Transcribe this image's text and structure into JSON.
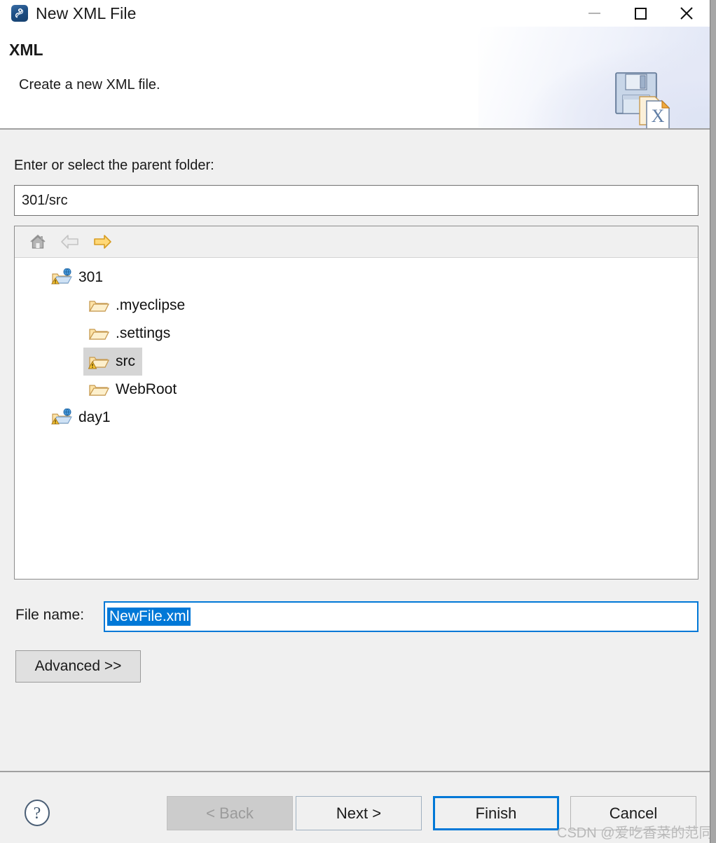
{
  "window": {
    "title": "New XML File",
    "icon": "xml-wizard-icon",
    "controls": {
      "minimize": "minimize-icon",
      "maximize": "maximize-icon",
      "close": "close-icon"
    }
  },
  "header": {
    "title": "XML",
    "description": "Create a new XML file.",
    "art": "floppy-disk-xml-document-icon"
  },
  "form": {
    "parent_folder_label": "Enter or select the parent folder:",
    "parent_folder_value": "301/src",
    "file_name_label": "File name:",
    "file_name_value": "NewFile.xml",
    "advanced_label": "Advanced >>"
  },
  "tree_toolbar": [
    {
      "name": "home-icon",
      "enabled": true
    },
    {
      "name": "back-arrow-icon",
      "enabled": false
    },
    {
      "name": "forward-arrow-icon",
      "enabled": true
    }
  ],
  "tree": [
    {
      "label": "301",
      "icon": "project-folder-warning-icon",
      "depth": 0,
      "selected": false
    },
    {
      "label": ".myeclipse",
      "icon": "folder-open-icon",
      "depth": 1,
      "selected": false
    },
    {
      "label": ".settings",
      "icon": "folder-open-icon",
      "depth": 1,
      "selected": false
    },
    {
      "label": "src",
      "icon": "folder-open-warning-icon",
      "depth": 1,
      "selected": true
    },
    {
      "label": "WebRoot",
      "icon": "folder-open-icon",
      "depth": 1,
      "selected": false
    },
    {
      "label": "day1",
      "icon": "project-folder-warning-icon",
      "depth": 0,
      "selected": false
    }
  ],
  "footer": {
    "help_icon": "help-question-icon",
    "buttons": [
      {
        "label": "< Back",
        "enabled": false,
        "default": false
      },
      {
        "label": "Next >",
        "enabled": true,
        "default": false
      },
      {
        "label": "Finish",
        "enabled": true,
        "default": true
      },
      {
        "label": "Cancel",
        "enabled": true,
        "default": false
      }
    ]
  },
  "watermark": "CSDN @爱吃香菜的范同学",
  "colors": {
    "accent": "#0078d7",
    "dialog_bg": "#f0f0f0",
    "field_bg": "#ffffff",
    "selection_bg": "#d5d5d5",
    "disabled_text": "#9b9b9b"
  }
}
